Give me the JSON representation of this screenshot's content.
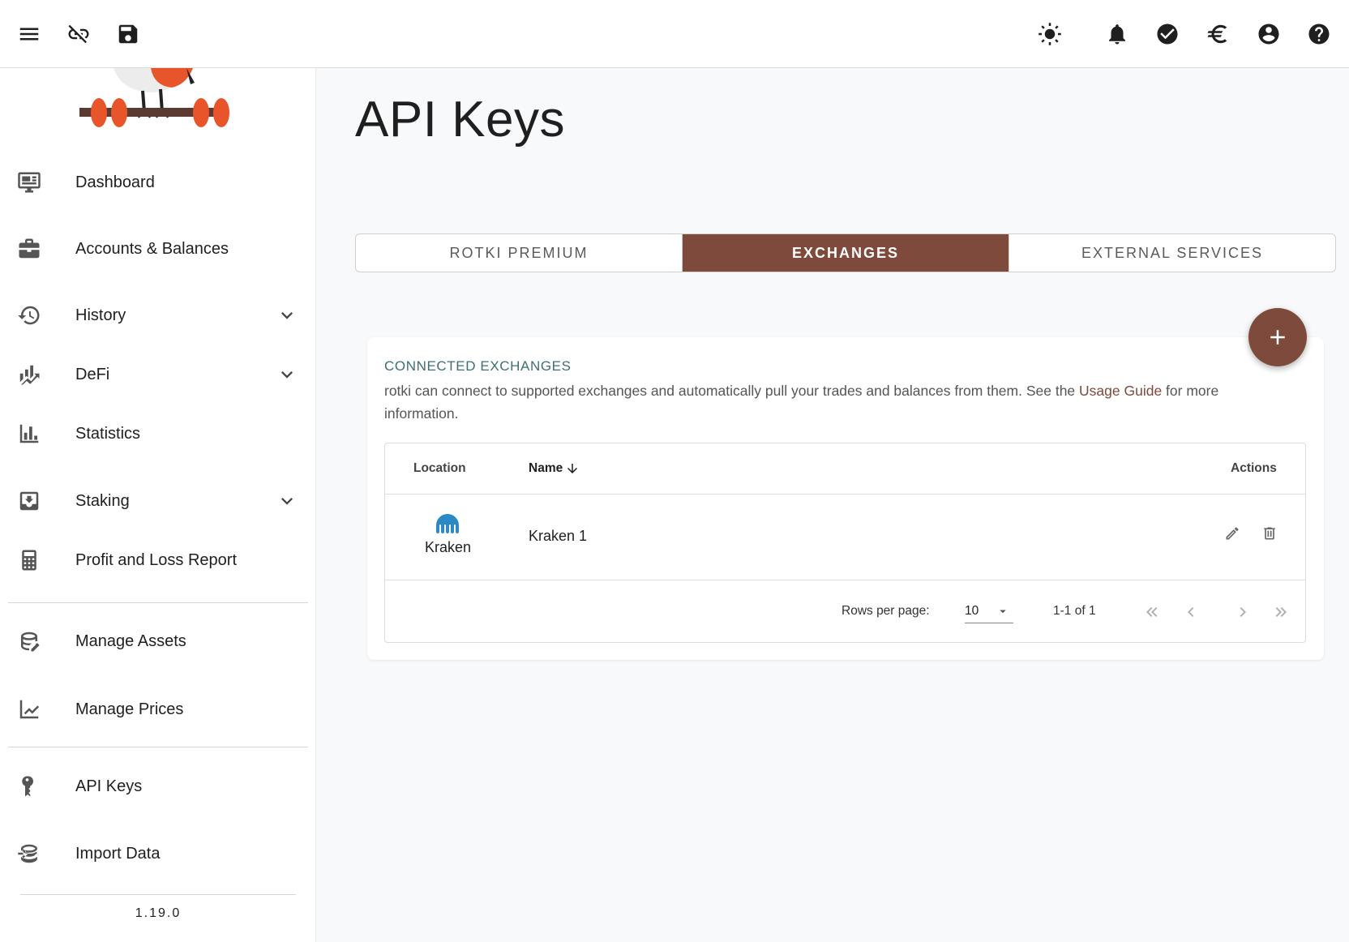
{
  "topbar": {
    "icons": [
      "menu-icon",
      "link-off-icon",
      "save-icon",
      "theme-brightness-icon",
      "notifications-bell-icon",
      "pending-tasks-check-icon",
      "currency-euro-icon",
      "account-circle-icon",
      "help-icon"
    ]
  },
  "sidebar": {
    "items": [
      {
        "label": "Dashboard",
        "icon": "monitor-dashboard-icon"
      },
      {
        "label": "Accounts & Balances",
        "icon": "briefcase-icon"
      },
      {
        "label": "History",
        "icon": "history-icon"
      },
      {
        "label": "DeFi",
        "icon": "finance-chart-icon"
      },
      {
        "label": "Statistics",
        "icon": "bar-chart-icon"
      },
      {
        "label": "Staking",
        "icon": "inbox-download-icon"
      },
      {
        "label": "Profit and Loss Report",
        "icon": "calculator-icon"
      },
      {
        "label": "Manage Assets",
        "icon": "database-edit-icon"
      },
      {
        "label": "Manage Prices",
        "icon": "chart-line-icon"
      },
      {
        "label": "API Keys",
        "icon": "key-chain-icon"
      },
      {
        "label": "Import Data",
        "icon": "database-import-icon"
      }
    ],
    "version": "1.19.0"
  },
  "main": {
    "title": "API Keys",
    "tabs": [
      {
        "label": "ROTKI PREMIUM"
      },
      {
        "label": "EXCHANGES"
      },
      {
        "label": "EXTERNAL SERVICES"
      }
    ],
    "card": {
      "title": "CONNECTED EXCHANGES",
      "desc_before": "rotki can connect to supported exchanges and automatically pull your trades and balances from them. See the ",
      "desc_link": "Usage Guide",
      "desc_after": " for more information.",
      "table": {
        "headers": {
          "location": "Location",
          "name": "Name",
          "actions": "Actions"
        },
        "rows": [
          {
            "location": "Kraken",
            "name": "Kraken 1"
          }
        ],
        "footer": {
          "rows_per_page_label": "Rows per page:",
          "rows_per_page_value": "10",
          "range": "1-1 of 1"
        }
      }
    }
  },
  "colors": {
    "accent": "#7e4a3b",
    "title": "#3e6f73",
    "kraken": "#2b8ac6"
  }
}
